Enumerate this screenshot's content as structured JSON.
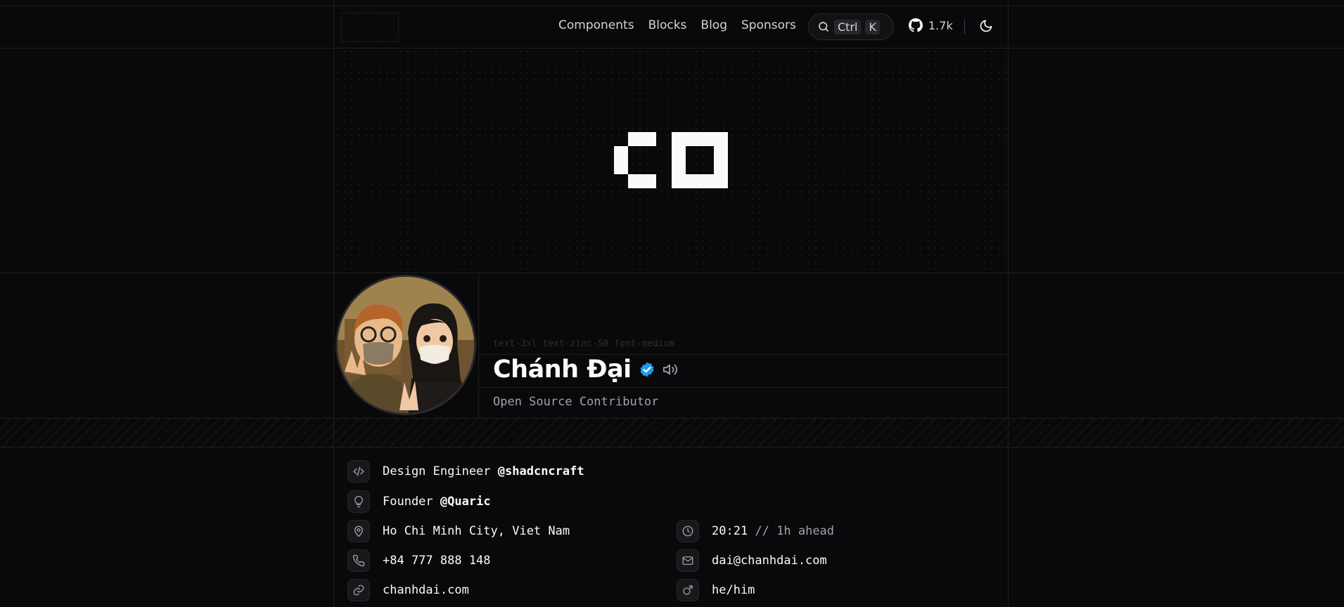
{
  "nav": {
    "items": [
      "Components",
      "Blocks",
      "Blog",
      "Sponsors"
    ],
    "search_key1": "Ctrl",
    "search_key2": "K",
    "github_stars": "1.7k"
  },
  "profile": {
    "class_hint": "text-3xl text-zinc-50 font-medium",
    "name": "Chánh Đại",
    "role": "Open Source Contributor"
  },
  "info": {
    "job_title": "Design Engineer",
    "job_company": "@shadcncraft",
    "founder_title": "Founder",
    "founder_company": "@Quaric",
    "location": "Ho Chi Minh City, Viet Nam",
    "time": "20:21",
    "time_note": "// 1h ahead",
    "phone": "+84 777 888 148",
    "email": "dai@chanhdai.com",
    "website": "chanhdai.com",
    "pronouns": "he/him"
  },
  "colors": {
    "background": "#09090b",
    "verified": "#1d9bf0",
    "text": "#fafafa",
    "muted": "#a1a1aa"
  }
}
